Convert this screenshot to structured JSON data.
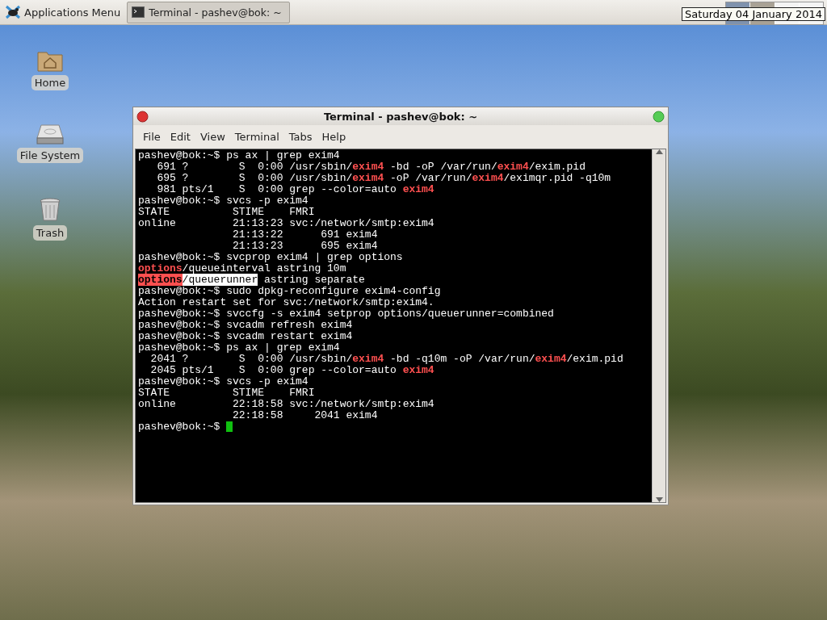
{
  "panel": {
    "menu_label": "Applications Menu",
    "tasks": [
      {
        "label": "Terminal - pashev@bok: ~",
        "selected": true
      }
    ],
    "clock_tooltip": "Saturday 04 January 2014"
  },
  "desktop_icons": [
    {
      "kind": "home",
      "label": "Home"
    },
    {
      "kind": "drive",
      "label": "File System"
    },
    {
      "kind": "trash",
      "label": "Trash"
    }
  ],
  "window": {
    "title": "Terminal - pashev@bok: ~",
    "menu": [
      "File",
      "Edit",
      "View",
      "Terminal",
      "Tabs",
      "Help"
    ],
    "lines": [
      [
        {
          "kind": "text",
          "t": "pashev@bok:~$ ps ax | grep exim4"
        }
      ],
      [
        {
          "kind": "text",
          "t": "   691 ?        S  0:00 /usr/sbin/"
        },
        {
          "kind": "match",
          "t": "exim4"
        },
        {
          "kind": "text",
          "t": " -bd -oP /var/run/"
        },
        {
          "kind": "match",
          "t": "exim4"
        },
        {
          "kind": "text",
          "t": "/exim.pid"
        }
      ],
      [
        {
          "kind": "text",
          "t": "   695 ?        S  0:00 /usr/sbin/"
        },
        {
          "kind": "match",
          "t": "exim4"
        },
        {
          "kind": "text",
          "t": " -oP /var/run/"
        },
        {
          "kind": "match",
          "t": "exim4"
        },
        {
          "kind": "text",
          "t": "/eximqr.pid -q10m"
        }
      ],
      [
        {
          "kind": "text",
          "t": "   981 pts/1    S  0:00 grep --color=auto "
        },
        {
          "kind": "match",
          "t": "exim4"
        }
      ],
      [
        {
          "kind": "text",
          "t": "pashev@bok:~$ svcs -p exim4"
        }
      ],
      [
        {
          "kind": "text",
          "t": "STATE          STIME    FMRI"
        }
      ],
      [
        {
          "kind": "text",
          "t": "online         21:13:23 svc:/network/smtp:exim4"
        }
      ],
      [
        {
          "kind": "text",
          "t": "               21:13:22      691 exim4"
        }
      ],
      [
        {
          "kind": "text",
          "t": "               21:13:23      695 exim4"
        }
      ],
      [
        {
          "kind": "text",
          "t": "pashev@bok:~$ svcprop exim4 | grep options"
        }
      ],
      [
        {
          "kind": "match",
          "t": "options"
        },
        {
          "kind": "text",
          "t": "/queueinterval astring 10m"
        }
      ],
      [
        {
          "kind": "match_hl",
          "t": "options"
        },
        {
          "kind": "selected",
          "t": "/queuerunner"
        },
        {
          "kind": "text",
          "t": " astring separate"
        }
      ],
      [
        {
          "kind": "text",
          "t": "pashev@bok:~$ sudo dpkg-reconfigure exim4-config"
        }
      ],
      [
        {
          "kind": "text",
          "t": "Action restart set for svc:/network/smtp:exim4."
        }
      ],
      [
        {
          "kind": "text",
          "t": "pashev@bok:~$ svccfg -s exim4 setprop options/queuerunner=combined"
        }
      ],
      [
        {
          "kind": "text",
          "t": "pashev@bok:~$ svcadm refresh exim4"
        }
      ],
      [
        {
          "kind": "text",
          "t": "pashev@bok:~$ svcadm restart exim4"
        }
      ],
      [
        {
          "kind": "text",
          "t": "pashev@bok:~$ ps ax | grep exim4"
        }
      ],
      [
        {
          "kind": "text",
          "t": "  2041 ?        S  0:00 /usr/sbin/"
        },
        {
          "kind": "match",
          "t": "exim4"
        },
        {
          "kind": "text",
          "t": " -bd -q10m -oP /var/run/"
        },
        {
          "kind": "match",
          "t": "exim4"
        },
        {
          "kind": "text",
          "t": "/exim.pid"
        }
      ],
      [
        {
          "kind": "text",
          "t": "  2045 pts/1    S  0:00 grep --color=auto "
        },
        {
          "kind": "match",
          "t": "exim4"
        }
      ],
      [
        {
          "kind": "text",
          "t": "pashev@bok:~$ svcs -p exim4"
        }
      ],
      [
        {
          "kind": "text",
          "t": "STATE          STIME    FMRI"
        }
      ],
      [
        {
          "kind": "text",
          "t": "online         22:18:58 svc:/network/smtp:exim4"
        }
      ],
      [
        {
          "kind": "text",
          "t": "               22:18:58     2041 exim4"
        }
      ]
    ],
    "prompt": "pashev@bok:~$ "
  }
}
